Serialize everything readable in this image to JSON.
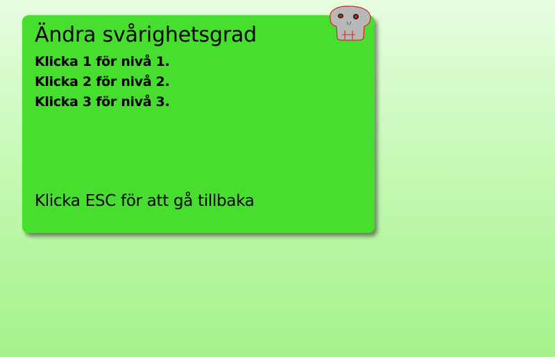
{
  "menu": {
    "title": "Ändra svårighetsgrad",
    "options": [
      "Klicka 1 för nivå 1.",
      "Klicka 2 för nivå 2.",
      "Klicka 3 för nivå 3."
    ],
    "back_hint": "Klicka ESC för att gå tillbaka"
  },
  "icons": {
    "mascot": "skull-icon"
  },
  "colors": {
    "panel": "#47de30",
    "background_top": "#e6fde0",
    "background_bottom": "#a4f28a",
    "skull": "#b8b8b8",
    "skull_outline": "#e02020"
  }
}
